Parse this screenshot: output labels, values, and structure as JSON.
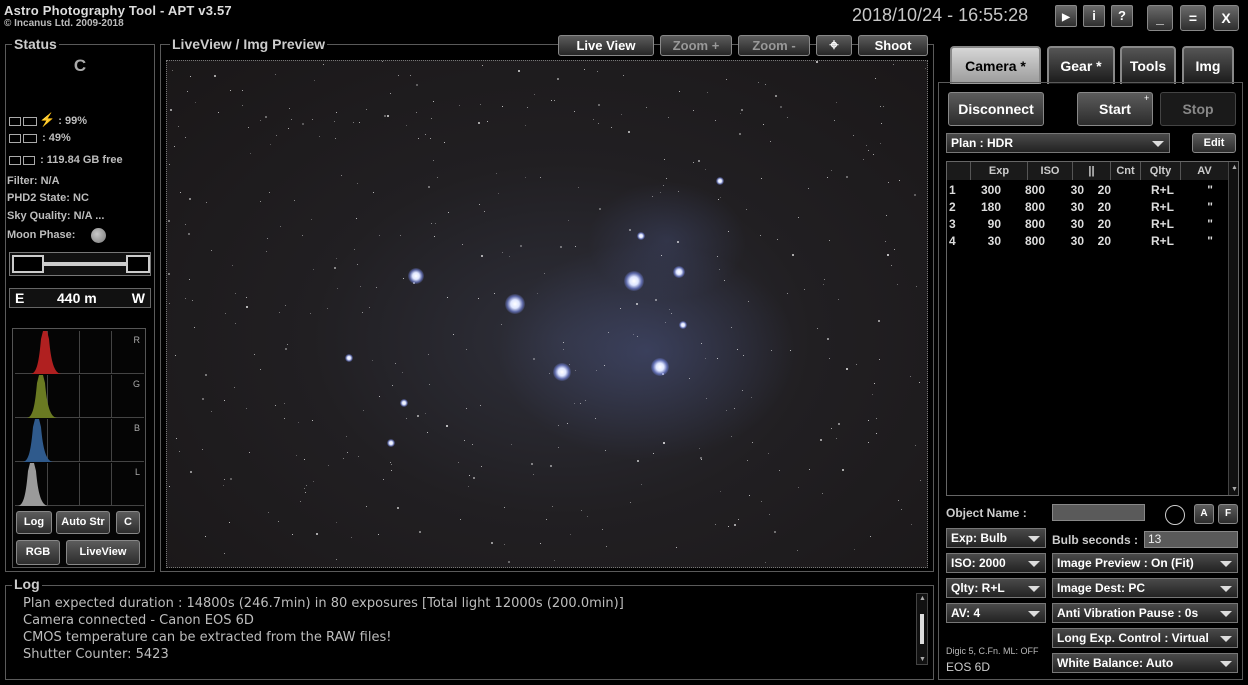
{
  "app": {
    "title": "Astro Photography Tool  -  APT v3.57",
    "copyright": "© Incanus Ltd. 2009-2018",
    "datetime": "2018/10/24 - 16:55:28",
    "window_buttons": [
      "▶",
      "i",
      "?",
      "_",
      "=",
      "X"
    ]
  },
  "status": {
    "legend": "Status",
    "big_letter": "C",
    "battery_pc": ": 99%",
    "battery_cam": ": 49%",
    "storage": ": 119.84 GB free",
    "filter": "Filter: N/A",
    "phd2": "PHD2 State: NC",
    "sky_quality": "Sky Quality: N/A ...",
    "moon_phase_label": "Moon Phase:",
    "focus_east": "E",
    "focus_distance": "440 m",
    "focus_west": "W",
    "hist_labels": [
      "R",
      "G",
      "B",
      "L"
    ],
    "hist_colors": [
      "#b02020",
      "#6a7a22",
      "#2f5a8c",
      "#9a9a9a"
    ],
    "buttons": {
      "log": "Log",
      "auto_str": "Auto Str",
      "c": "C",
      "rgb": "RGB",
      "liveview": "LiveView"
    }
  },
  "preview": {
    "legend": "LiveView / Img Preview",
    "live_view": "Live View",
    "zoom_in": "Zoom +",
    "zoom_out": "Zoom -",
    "crosshair": "⌖",
    "shoot": "Shoot"
  },
  "tabs": [
    {
      "label": "Camera *",
      "active": true
    },
    {
      "label": "Gear *",
      "active": false
    },
    {
      "label": "Tools",
      "active": false
    },
    {
      "label": "Img",
      "active": false
    }
  ],
  "camera": {
    "disconnect": "Disconnect",
    "start": "Start",
    "stop": "Stop",
    "plan": "Plan : HDR",
    "edit": "Edit",
    "plan_columns": [
      "Exp",
      "ISO",
      "||",
      "Cnt",
      "Qlty",
      "AV"
    ],
    "plan_rows": [
      {
        "n": "1",
        "exp": "300",
        "iso": "800",
        "pause": "30",
        "cnt": "20",
        "qlty": "R+L",
        "av": "\""
      },
      {
        "n": "2",
        "exp": "180",
        "iso": "800",
        "pause": "30",
        "cnt": "20",
        "qlty": "R+L",
        "av": "\""
      },
      {
        "n": "3",
        "exp": "90",
        "iso": "800",
        "pause": "30",
        "cnt": "20",
        "qlty": "R+L",
        "av": "\""
      },
      {
        "n": "4",
        "exp": "30",
        "iso": "800",
        "pause": "30",
        "cnt": "20",
        "qlty": "R+L",
        "av": "\""
      }
    ],
    "object_name_label": "Object Name :",
    "object_name_value": "",
    "btn_a": "A",
    "btn_f": "F",
    "exp": "Exp: Bulb",
    "bulb_label": "Bulb seconds :",
    "bulb_value": "13",
    "iso": "ISO: 2000",
    "image_preview": "Image Preview : On (Fit)",
    "qlty": "Qlty: R+L",
    "image_dest": "Image Dest: PC",
    "av": "AV: 4",
    "anti_vibration": "Anti Vibration Pause : 0s",
    "cam_info": "Digic 5, C.Fn. ML: OFF",
    "cam_model": "EOS 6D",
    "long_exp": "Long Exp. Control : Virtual",
    "white_balance": "White Balance: Auto"
  },
  "log": {
    "legend": "Log",
    "lines": [
      "Plan expected duration : 14800s (246.7min) in 80 exposures [Total light 12000s (200.0min)]",
      "Camera connected - Canon EOS 6D",
      "CMOS temperature can be extracted from the RAW files!",
      "Shutter Counter: 5423"
    ]
  }
}
